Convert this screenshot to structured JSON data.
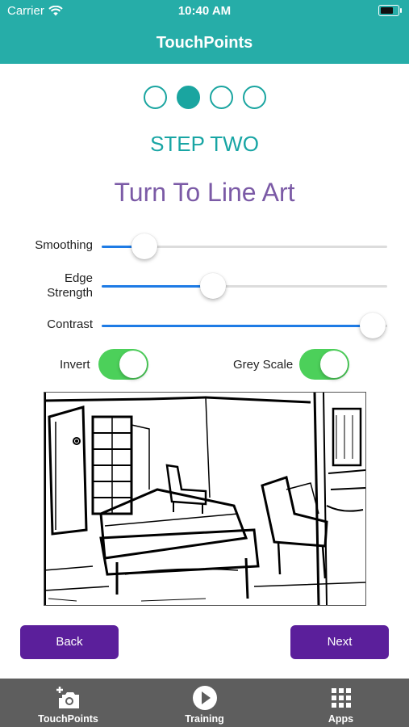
{
  "status_bar": {
    "carrier": "Carrier",
    "time": "10:40 AM"
  },
  "nav": {
    "title": "TouchPoints"
  },
  "steps": {
    "count": 4,
    "active_index": 1,
    "label": "STEP TWO"
  },
  "page": {
    "title": "Turn To Line Art"
  },
  "sliders": {
    "smoothing": {
      "label": "Smoothing",
      "value": 0.15
    },
    "edge_strength": {
      "label": "Edge\nStrength",
      "value": 0.39
    },
    "contrast": {
      "label": "Contrast",
      "value": 0.95
    }
  },
  "toggles": {
    "invert": {
      "label": "Invert",
      "on": true
    },
    "grey_scale": {
      "label": "Grey Scale",
      "on": true
    }
  },
  "buttons": {
    "back": "Back",
    "next": "Next"
  },
  "tab_bar": {
    "items": [
      {
        "label": "TouchPoints",
        "icon": "add-photo-camera-icon"
      },
      {
        "label": "Training",
        "icon": "play-circle-icon"
      },
      {
        "label": "Apps",
        "icon": "apps-grid-icon"
      }
    ]
  },
  "colors": {
    "header": "#26ada8",
    "step": "#1aa5a0",
    "title": "#7b5aa6",
    "slider_fill": "#1e7be5",
    "toggle_on": "#4cd05a",
    "button": "#5b1f9b",
    "tab_bar": "#5e5e5e"
  }
}
